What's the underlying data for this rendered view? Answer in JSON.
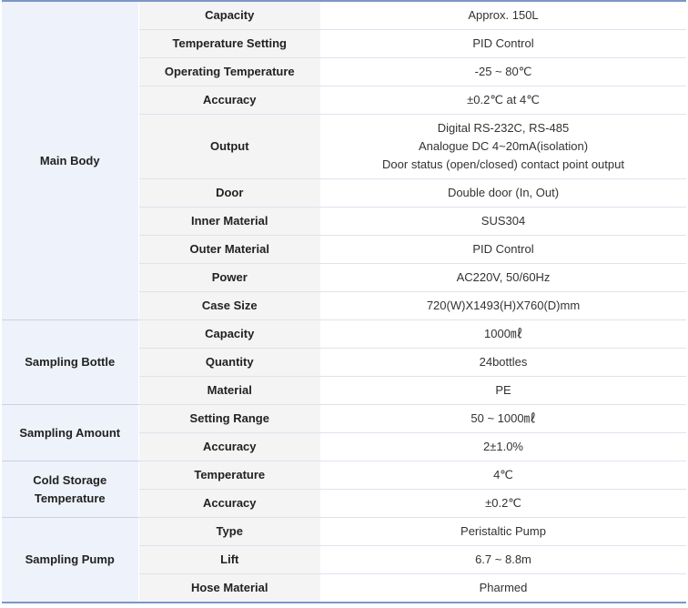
{
  "groups": [
    {
      "name": "Main Body",
      "rows": [
        {
          "label": "Capacity",
          "value": [
            "Approx. 150L"
          ]
        },
        {
          "label": "Temperature Setting",
          "value": [
            "PID Control"
          ]
        },
        {
          "label": "Operating Temperature",
          "value": [
            "-25 ~ 80℃"
          ]
        },
        {
          "label": "Accuracy",
          "value": [
            "±0.2℃ at 4℃"
          ]
        },
        {
          "label": "Output",
          "value": [
            "Digital RS-232C, RS-485",
            "Analogue DC 4~20mA(isolation)",
            "Door status (open/closed) contact point output"
          ]
        },
        {
          "label": "Door",
          "value": [
            "Double door (In, Out)"
          ]
        },
        {
          "label": "Inner Material",
          "value": [
            "SUS304"
          ]
        },
        {
          "label": "Outer Material",
          "value": [
            "PID Control"
          ]
        },
        {
          "label": "Power",
          "value": [
            "AC220V, 50/60Hz"
          ]
        },
        {
          "label": "Case Size",
          "value": [
            "720(W)X1493(H)X760(D)mm"
          ]
        }
      ]
    },
    {
      "name": "Sampling Bottle",
      "rows": [
        {
          "label": "Capacity",
          "value": [
            "1000㎖"
          ]
        },
        {
          "label": "Quantity",
          "value": [
            "24bottles"
          ]
        },
        {
          "label": "Material",
          "value": [
            "PE"
          ]
        }
      ]
    },
    {
      "name": "Sampling Amount",
      "rows": [
        {
          "label": "Setting Range",
          "value": [
            "50 ~ 1000㎖"
          ]
        },
        {
          "label": "Accuracy",
          "value": [
            "2±1.0%"
          ]
        }
      ]
    },
    {
      "name": "Cold Storage Temperature",
      "name_lines": [
        "Cold Storage",
        "Temperature"
      ],
      "rows": [
        {
          "label": "Temperature",
          "value": [
            "4℃"
          ]
        },
        {
          "label": "Accuracy",
          "value": [
            "±0.2℃"
          ]
        }
      ]
    },
    {
      "name": "Sampling Pump",
      "rows": [
        {
          "label": "Type",
          "value": [
            "Peristaltic Pump"
          ]
        },
        {
          "label": "Lift",
          "value": [
            "6.7 ~ 8.8m"
          ]
        },
        {
          "label": "Hose Material",
          "value": [
            "Pharmed"
          ]
        }
      ]
    }
  ]
}
